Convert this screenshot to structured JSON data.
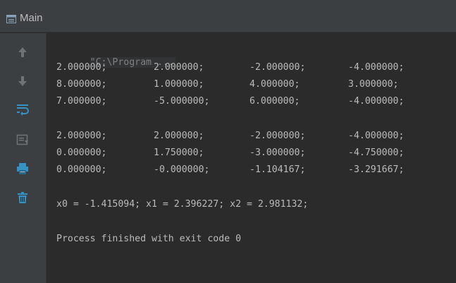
{
  "window": {
    "title": "Main",
    "icon": "window-icon"
  },
  "toolbar": {
    "buttons": [
      {
        "name": "rerun-up-icon",
        "color": "#6e7376"
      },
      {
        "name": "rerun-down-icon",
        "color": "#6e7376"
      },
      {
        "name": "soft-wrap-icon",
        "color": "#3592c4"
      },
      {
        "name": "scroll-to-end-icon",
        "color": "#6e7376"
      },
      {
        "name": "print-icon",
        "color": "#3592c4"
      },
      {
        "name": "clear-all-icon",
        "color": "#3592c4"
      }
    ]
  },
  "console": {
    "command": "\"C:\\Program ...",
    "matrix1": [
      [
        "2.000000;",
        "2.000000;",
        "-2.000000;",
        "-4.000000;"
      ],
      [
        "8.000000;",
        "1.000000;",
        "4.000000;",
        "3.000000;"
      ],
      [
        "7.000000;",
        "-5.000000;",
        "6.000000;",
        "-4.000000;"
      ]
    ],
    "matrix2": [
      [
        "2.000000;",
        "2.000000;",
        "-2.000000;",
        "-4.000000;"
      ],
      [
        "0.000000;",
        "1.750000;",
        "-3.000000;",
        "-4.750000;"
      ],
      [
        "0.000000;",
        "-0.000000;",
        "-1.104167;",
        "-3.291667;"
      ]
    ],
    "solution": "x0 = -1.415094; x1 = 2.396227; x2 = 2.981132;",
    "exit_message": "Process finished with exit code 0"
  },
  "colors": {
    "background": "#2b2b2b",
    "panel": "#3c3f41",
    "text": "#bbbbbb",
    "command_text": "#808080",
    "accent_icon": "#3592c4"
  }
}
